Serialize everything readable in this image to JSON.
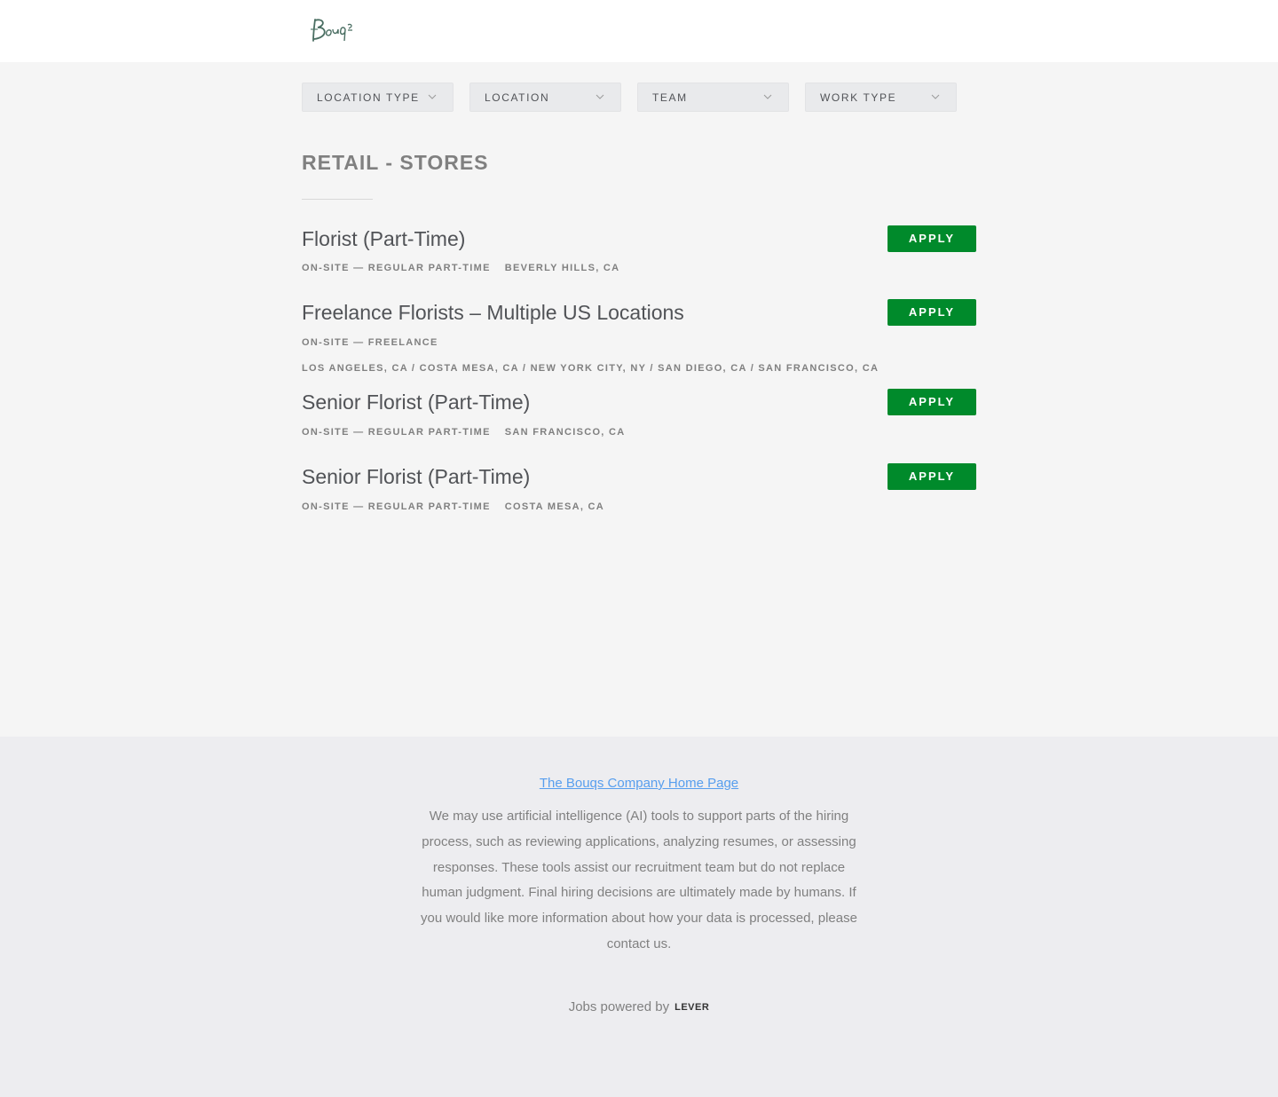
{
  "header": {
    "logo_alt": "Bouqs"
  },
  "filters": [
    {
      "label": "LOCATION TYPE"
    },
    {
      "label": "LOCATION"
    },
    {
      "label": "TEAM"
    },
    {
      "label": "WORK TYPE"
    }
  ],
  "section": {
    "title": "RETAIL - STORES"
  },
  "postings": [
    {
      "title": "Florist (Part-Time)",
      "commitment": "ON-SITE — REGULAR PART-TIME",
      "location": "BEVERLY HILLS, CA",
      "apply_label": "APPLY"
    },
    {
      "title": "Freelance Florists – Multiple US Locations",
      "commitment": "ON-SITE — FREELANCE",
      "location": "LOS ANGELES, CA / COSTA MESA, CA / NEW YORK CITY, NY / SAN DIEGO, CA / SAN FRANCISCO, CA",
      "apply_label": "APPLY"
    },
    {
      "title": "Senior Florist (Part-Time)",
      "commitment": "ON-SITE — REGULAR PART-TIME",
      "location": "SAN FRANCISCO, CA",
      "apply_label": "APPLY"
    },
    {
      "title": "Senior Florist (Part-Time)",
      "commitment": "ON-SITE — REGULAR PART-TIME",
      "location": "COSTA MESA, CA",
      "apply_label": "APPLY"
    }
  ],
  "footer": {
    "home_link": "The Bouqs Company Home Page",
    "ai_notice": "We may use artificial intelligence (AI) tools to support parts of the hiring process, such as reviewing applications, analyzing resumes, or assessing responses. These tools assist our recruitment team but do not replace human judgment. Final hiring decisions are ultimately made by humans. If you would like more information about how your data is processed, please contact us.",
    "powered_by": "Jobs powered by",
    "powered_brand": "LEVER"
  }
}
